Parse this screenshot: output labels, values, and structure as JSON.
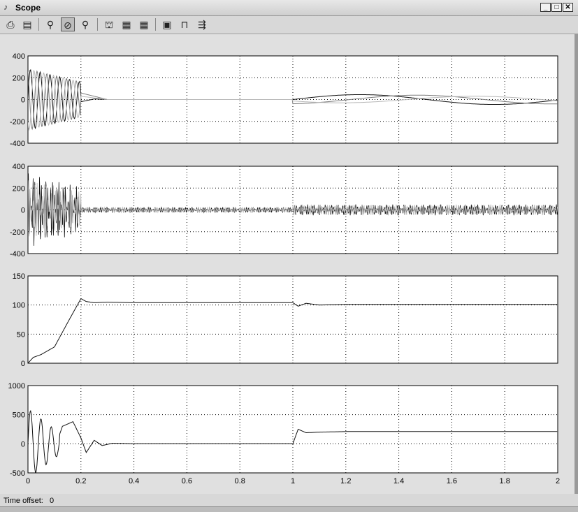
{
  "window": {
    "title": "Scope",
    "title_icon": "scope-icon",
    "controls": [
      "minimize",
      "maximize",
      "close"
    ]
  },
  "toolbar": {
    "buttons": [
      {
        "name": "print-icon",
        "glyph": "🖶"
      },
      {
        "name": "parameters-icon",
        "glyph": "▤"
      },
      {
        "name": "zoom-icon",
        "glyph": "⚲"
      },
      {
        "name": "zoom-x-icon",
        "glyph": "⚲",
        "active": true
      },
      {
        "name": "zoom-y-icon",
        "glyph": "⚲"
      },
      {
        "name": "autoscale-icon",
        "glyph": "⌖"
      },
      {
        "name": "save-axes-icon",
        "glyph": "▦"
      },
      {
        "name": "restore-axes-icon",
        "glyph": "▦"
      },
      {
        "name": "floating-scope-icon",
        "glyph": "▣"
      },
      {
        "name": "lock-icon",
        "glyph": "🔒"
      },
      {
        "name": "signal-selection-icon",
        "glyph": "⇶"
      }
    ]
  },
  "status": {
    "label": "Time offset:",
    "value": "0"
  },
  "colors": {
    "background": "#e0e0e0",
    "axes_background": "#ffffff",
    "grid": "#000000",
    "trace_dark": "#111111",
    "trace_gray": "#7a7a7a",
    "trace_light": "#b8b8b8"
  },
  "chart_data": [
    {
      "type": "line",
      "title": "",
      "xlabel": "",
      "ylabel": "",
      "xlim": [
        0,
        2
      ],
      "ylim": [
        -400,
        400
      ],
      "yticks": [
        "400",
        "200",
        "0",
        "-200",
        "-400"
      ],
      "grid": true,
      "series": [
        {
          "values_x": [
            0,
            0.02,
            0.05,
            0.08,
            0.12,
            0.16,
            0.2,
            0.25,
            0.3,
            1.0,
            1.02,
            1.1,
            1.2,
            1.4,
            1.6,
            1.8,
            2.0
          ],
          "values_y": [
            0,
            300,
            -300,
            280,
            -250,
            200,
            -20,
            5,
            0,
            0,
            40,
            50,
            40,
            -40,
            -20,
            50,
            -10
          ]
        },
        {
          "values_x": [
            0,
            0.03,
            0.07,
            0.11,
            0.15,
            0.2,
            0.3,
            1.0,
            1.1,
            1.3,
            1.5,
            1.7,
            1.9,
            2.0
          ],
          "values_y": [
            0,
            250,
            -260,
            240,
            -220,
            60,
            0,
            0,
            -10,
            -40,
            0,
            40,
            -30,
            -20
          ]
        },
        {
          "values_x": [
            0,
            0.04,
            0.1,
            0.15,
            0.2,
            0.3,
            1.0,
            1.2,
            1.5,
            1.8,
            2.0
          ],
          "values_y": [
            0,
            200,
            -180,
            150,
            30,
            0,
            0,
            20,
            40,
            20,
            30
          ]
        }
      ]
    },
    {
      "type": "line",
      "title": "",
      "xlabel": "",
      "ylabel": "",
      "xlim": [
        0,
        2
      ],
      "ylim": [
        -400,
        400
      ],
      "yticks": [
        "400",
        "200",
        "0",
        "-200",
        "-400"
      ],
      "grid": true,
      "series": [
        {
          "values_x": [
            0,
            0.2,
            1.0,
            2.0
          ],
          "values_y": [
            0,
            0,
            0,
            0
          ],
          "description_amp": [
            350,
            25,
            50
          ]
        }
      ]
    },
    {
      "type": "line",
      "title": "",
      "xlabel": "",
      "ylabel": "",
      "xlim": [
        0,
        2
      ],
      "ylim": [
        0,
        150
      ],
      "yticks": [
        "150",
        "100",
        "50",
        "0"
      ],
      "grid": true,
      "series": [
        {
          "values_x": [
            0,
            0.02,
            0.05,
            0.1,
            0.15,
            0.2,
            0.22,
            0.25,
            0.3,
            0.4,
            1.0,
            1.02,
            1.05,
            1.1,
            1.2,
            2.0
          ],
          "values_y": [
            0,
            10,
            15,
            28,
            70,
            111,
            106,
            104,
            105,
            104,
            104,
            98,
            103,
            100,
            101,
            101
          ]
        }
      ]
    },
    {
      "type": "line",
      "title": "",
      "xlabel": "",
      "ylabel": "",
      "xlim": [
        0,
        2
      ],
      "ylim": [
        -500,
        1000
      ],
      "yticks": [
        "1000",
        "500",
        "0",
        "-500"
      ],
      "xticks": [
        "0",
        "0.2",
        "0.4",
        "0.6",
        "0.8",
        "1",
        "1.2",
        "1.4",
        "1.6",
        "1.8",
        "2"
      ],
      "grid": true,
      "series": [
        {
          "values_x": [
            0,
            0.01,
            0.02,
            0.04,
            0.06,
            0.08,
            0.1,
            0.13,
            0.17,
            0.2,
            0.22,
            0.25,
            0.28,
            0.32,
            0.4,
            1.0,
            1.02,
            1.05,
            1.1,
            1.2,
            2.0
          ],
          "values_y": [
            0,
            600,
            -300,
            500,
            -350,
            420,
            -100,
            300,
            380,
            100,
            -150,
            60,
            -30,
            10,
            0,
            0,
            250,
            190,
            200,
            210,
            210
          ]
        }
      ]
    }
  ]
}
